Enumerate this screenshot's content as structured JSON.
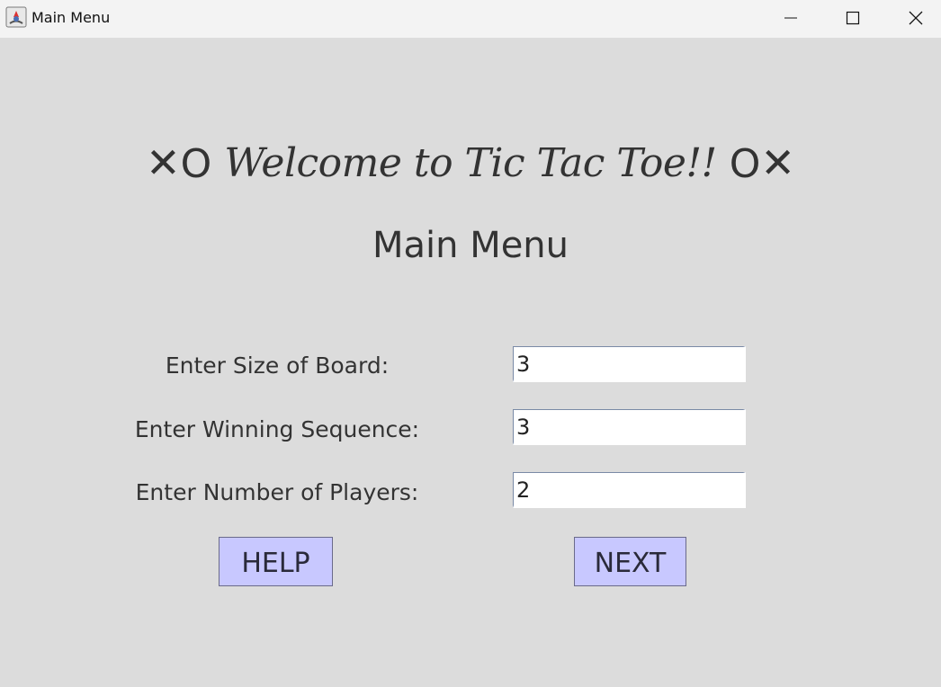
{
  "window": {
    "title": "Main Menu",
    "controls": {
      "minimize_icon": "minimize-icon",
      "maximize_icon": "maximize-icon",
      "close_icon": "close-icon"
    }
  },
  "header": {
    "left_symbols_x": "✕",
    "left_symbols_o": "O",
    "welcome": "Welcome to Tic Tac Toe!!",
    "right_symbols_o": "O",
    "right_symbols_x": "✕"
  },
  "subtitle": "Main Menu",
  "form": {
    "fields": [
      {
        "label": "Enter Size of Board:",
        "value": "3"
      },
      {
        "label": "Enter Winning Sequence:",
        "value": "3"
      },
      {
        "label": "Enter Number of Players:",
        "value": "2"
      }
    ]
  },
  "buttons": {
    "help": "HELP",
    "next": "NEXT"
  },
  "colors": {
    "background": "#dcdcdc",
    "button_fill": "#c8c8ff",
    "text": "#333333"
  }
}
